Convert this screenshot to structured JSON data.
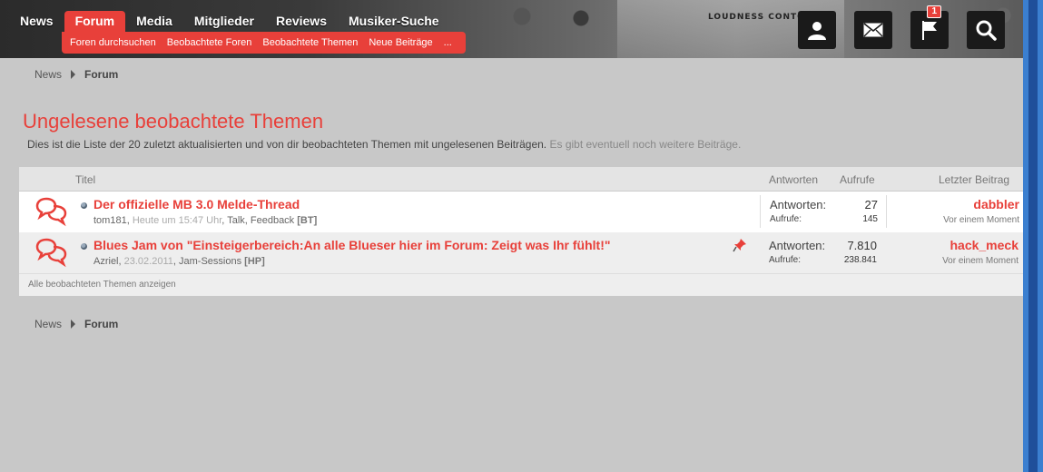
{
  "nav": {
    "items": [
      "News",
      "Forum",
      "Media",
      "Mitglieder",
      "Reviews",
      "Musiker-Suche"
    ],
    "active": "Forum",
    "subitems": [
      "Foren durchsuchen",
      "Beobachtete Foren",
      "Beobachtete Themen",
      "Neue Beiträge",
      "..."
    ],
    "header_panel_text": "LOUDNESS CONTOUR",
    "icons": [
      "user-icon",
      "envelope-icon",
      "flag-icon",
      "search-icon"
    ],
    "alerts_badge": "1"
  },
  "breadcrumb": {
    "home": "News",
    "current": "Forum"
  },
  "page": {
    "title": "Ungelesene beobachtete Themen",
    "description": "Dies ist die Liste der 20 zuletzt aktualisierten und von dir beobachteten Themen mit ungelesenen Beiträgen.",
    "description_more": "Es gibt eventuell noch weitere Beiträge."
  },
  "table": {
    "headers": {
      "title": "Titel",
      "replies": "Antworten",
      "views": "Aufrufe",
      "last": "Letzter Beitrag"
    },
    "rows": [
      {
        "title": "Der offizielle MB 3.0 Melde-Thread",
        "author": "tom181",
        "date": "Heute um 15:47 Uhr",
        "forum": "Talk, Feedback",
        "tag": "[BT]",
        "replies_label": "Antworten:",
        "replies": "27",
        "views_label": "Aufrufe:",
        "views": "145",
        "last_user": "dabbler",
        "last_time": "Vor einem Moment",
        "sticky": false
      },
      {
        "title": "Blues Jam von \"Einsteigerbereich:An alle Blueser hier im Forum: Zeigt was Ihr fühlt!\"",
        "author": "Azriel",
        "date": "23.02.2011",
        "forum": "Jam-Sessions",
        "tag": "[HP]",
        "replies_label": "Antworten:",
        "replies": "7.810",
        "views_label": "Aufrufe:",
        "views": "238.841",
        "last_user": "hack_meck",
        "last_time": "Vor einem Moment",
        "sticky": true
      }
    ],
    "footer_link": "Alle beobachteten Themen anzeigen"
  },
  "colors": {
    "accent": "#e8403a",
    "background": "#c8c8c8"
  }
}
